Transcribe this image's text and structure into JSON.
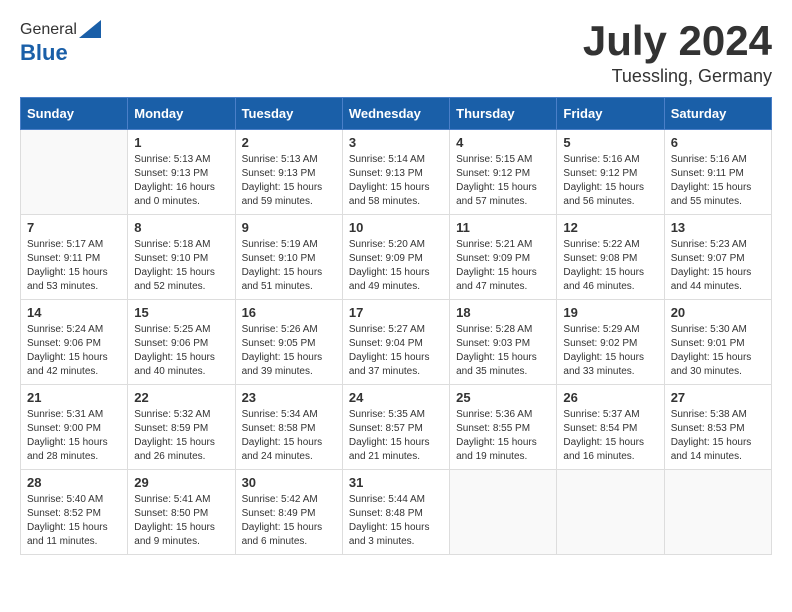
{
  "header": {
    "logo_general": "General",
    "logo_blue": "Blue",
    "month_year": "July 2024",
    "location": "Tuessling, Germany"
  },
  "days_of_week": [
    "Sunday",
    "Monday",
    "Tuesday",
    "Wednesday",
    "Thursday",
    "Friday",
    "Saturday"
  ],
  "weeks": [
    [
      {
        "day": "",
        "info": ""
      },
      {
        "day": "1",
        "info": "Sunrise: 5:13 AM\nSunset: 9:13 PM\nDaylight: 16 hours\nand 0 minutes."
      },
      {
        "day": "2",
        "info": "Sunrise: 5:13 AM\nSunset: 9:13 PM\nDaylight: 15 hours\nand 59 minutes."
      },
      {
        "day": "3",
        "info": "Sunrise: 5:14 AM\nSunset: 9:13 PM\nDaylight: 15 hours\nand 58 minutes."
      },
      {
        "day": "4",
        "info": "Sunrise: 5:15 AM\nSunset: 9:12 PM\nDaylight: 15 hours\nand 57 minutes."
      },
      {
        "day": "5",
        "info": "Sunrise: 5:16 AM\nSunset: 9:12 PM\nDaylight: 15 hours\nand 56 minutes."
      },
      {
        "day": "6",
        "info": "Sunrise: 5:16 AM\nSunset: 9:11 PM\nDaylight: 15 hours\nand 55 minutes."
      }
    ],
    [
      {
        "day": "7",
        "info": "Sunrise: 5:17 AM\nSunset: 9:11 PM\nDaylight: 15 hours\nand 53 minutes."
      },
      {
        "day": "8",
        "info": "Sunrise: 5:18 AM\nSunset: 9:10 PM\nDaylight: 15 hours\nand 52 minutes."
      },
      {
        "day": "9",
        "info": "Sunrise: 5:19 AM\nSunset: 9:10 PM\nDaylight: 15 hours\nand 51 minutes."
      },
      {
        "day": "10",
        "info": "Sunrise: 5:20 AM\nSunset: 9:09 PM\nDaylight: 15 hours\nand 49 minutes."
      },
      {
        "day": "11",
        "info": "Sunrise: 5:21 AM\nSunset: 9:09 PM\nDaylight: 15 hours\nand 47 minutes."
      },
      {
        "day": "12",
        "info": "Sunrise: 5:22 AM\nSunset: 9:08 PM\nDaylight: 15 hours\nand 46 minutes."
      },
      {
        "day": "13",
        "info": "Sunrise: 5:23 AM\nSunset: 9:07 PM\nDaylight: 15 hours\nand 44 minutes."
      }
    ],
    [
      {
        "day": "14",
        "info": "Sunrise: 5:24 AM\nSunset: 9:06 PM\nDaylight: 15 hours\nand 42 minutes."
      },
      {
        "day": "15",
        "info": "Sunrise: 5:25 AM\nSunset: 9:06 PM\nDaylight: 15 hours\nand 40 minutes."
      },
      {
        "day": "16",
        "info": "Sunrise: 5:26 AM\nSunset: 9:05 PM\nDaylight: 15 hours\nand 39 minutes."
      },
      {
        "day": "17",
        "info": "Sunrise: 5:27 AM\nSunset: 9:04 PM\nDaylight: 15 hours\nand 37 minutes."
      },
      {
        "day": "18",
        "info": "Sunrise: 5:28 AM\nSunset: 9:03 PM\nDaylight: 15 hours\nand 35 minutes."
      },
      {
        "day": "19",
        "info": "Sunrise: 5:29 AM\nSunset: 9:02 PM\nDaylight: 15 hours\nand 33 minutes."
      },
      {
        "day": "20",
        "info": "Sunrise: 5:30 AM\nSunset: 9:01 PM\nDaylight: 15 hours\nand 30 minutes."
      }
    ],
    [
      {
        "day": "21",
        "info": "Sunrise: 5:31 AM\nSunset: 9:00 PM\nDaylight: 15 hours\nand 28 minutes."
      },
      {
        "day": "22",
        "info": "Sunrise: 5:32 AM\nSunset: 8:59 PM\nDaylight: 15 hours\nand 26 minutes."
      },
      {
        "day": "23",
        "info": "Sunrise: 5:34 AM\nSunset: 8:58 PM\nDaylight: 15 hours\nand 24 minutes."
      },
      {
        "day": "24",
        "info": "Sunrise: 5:35 AM\nSunset: 8:57 PM\nDaylight: 15 hours\nand 21 minutes."
      },
      {
        "day": "25",
        "info": "Sunrise: 5:36 AM\nSunset: 8:55 PM\nDaylight: 15 hours\nand 19 minutes."
      },
      {
        "day": "26",
        "info": "Sunrise: 5:37 AM\nSunset: 8:54 PM\nDaylight: 15 hours\nand 16 minutes."
      },
      {
        "day": "27",
        "info": "Sunrise: 5:38 AM\nSunset: 8:53 PM\nDaylight: 15 hours\nand 14 minutes."
      }
    ],
    [
      {
        "day": "28",
        "info": "Sunrise: 5:40 AM\nSunset: 8:52 PM\nDaylight: 15 hours\nand 11 minutes."
      },
      {
        "day": "29",
        "info": "Sunrise: 5:41 AM\nSunset: 8:50 PM\nDaylight: 15 hours\nand 9 minutes."
      },
      {
        "day": "30",
        "info": "Sunrise: 5:42 AM\nSunset: 8:49 PM\nDaylight: 15 hours\nand 6 minutes."
      },
      {
        "day": "31",
        "info": "Sunrise: 5:44 AM\nSunset: 8:48 PM\nDaylight: 15 hours\nand 3 minutes."
      },
      {
        "day": "",
        "info": ""
      },
      {
        "day": "",
        "info": ""
      },
      {
        "day": "",
        "info": ""
      }
    ]
  ]
}
